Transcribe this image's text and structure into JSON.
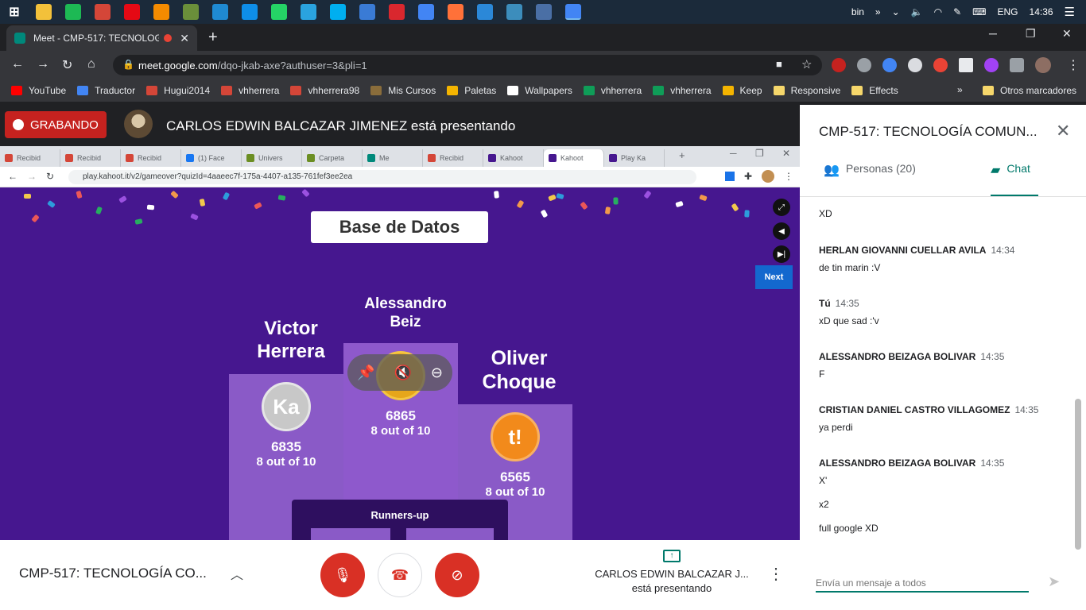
{
  "taskbar": {
    "icons": [
      {
        "name": "windows-start-icon",
        "color": "#1b2a3a"
      },
      {
        "name": "file-explorer-icon",
        "color": "#f3c13a"
      },
      {
        "name": "spotify-icon",
        "color": "#1db954"
      },
      {
        "name": "gmail-app-icon",
        "color": "#d44638"
      },
      {
        "name": "netflix-icon",
        "color": "#e50914"
      },
      {
        "name": "vlc-icon",
        "color": "#f48b00"
      },
      {
        "name": "app-icon",
        "color": "#6a8f3a"
      },
      {
        "name": "vscode-icon",
        "color": "#1f8ad2"
      },
      {
        "name": "teamviewer-icon",
        "color": "#0e8ee9"
      },
      {
        "name": "whatsapp-icon",
        "color": "#25d366"
      },
      {
        "name": "telegram-icon",
        "color": "#2aa3df"
      },
      {
        "name": "skype-icon",
        "color": "#00aff0"
      },
      {
        "name": "store-icon",
        "color": "#3a7bd5"
      },
      {
        "name": "mega-icon",
        "color": "#d9272e"
      },
      {
        "name": "drive-icon",
        "color": "#4285f4"
      },
      {
        "name": "firefox-icon",
        "color": "#ff7139"
      },
      {
        "name": "remote-desktop-icon",
        "color": "#2b88d8"
      },
      {
        "name": "search-app-icon",
        "color": "#3c8dbc"
      },
      {
        "name": "photos-icon",
        "color": "#4a6fa5"
      },
      {
        "name": "chrome-icon",
        "color": "#4285f4"
      }
    ],
    "tray_label": "bin",
    "language": "ENG",
    "clock": "14:36"
  },
  "browser": {
    "tab_title": "Meet - CMP-517: TECNOLOG",
    "url_host": "meet.google.com",
    "url_path": "/dqo-jkab-axe?authuser=3&pli=1",
    "new_tab": "+",
    "bookmarks": [
      {
        "label": "YouTube",
        "color": "#ff0000"
      },
      {
        "label": "Traductor",
        "color": "#4285f4"
      },
      {
        "label": "Hugui2014",
        "color": "#d44638"
      },
      {
        "label": "vhherrera",
        "color": "#d44638"
      },
      {
        "label": "vhherrera98",
        "color": "#d44638"
      },
      {
        "label": "Mis Cursos",
        "color": "#8a6d3b"
      },
      {
        "label": "Paletas",
        "color": "#f4b400"
      },
      {
        "label": "Wallpapers",
        "color": "#ffffff"
      },
      {
        "label": "vhherrera",
        "color": "#0f9d58"
      },
      {
        "label": "vhherrera",
        "color": "#0f9d58"
      },
      {
        "label": "Keep",
        "color": "#f4b400"
      },
      {
        "label": "Responsive",
        "color": "#f6d76b"
      },
      {
        "label": "Effects",
        "color": "#f6d76b"
      }
    ],
    "bookmarks_more": "»",
    "other_bookmarks": "Otros marcadores"
  },
  "meet": {
    "recording_label": "GRABANDO",
    "presenter_banner": "CARLOS EDWIN BALCAZAR JIMENEZ está presentando",
    "meeting_name": "CMP-517: TECNOLOGÍA CO...",
    "presenting_name": "CARLOS EDWIN BALCAZAR J...",
    "presenting_status": "está presentando",
    "panel": {
      "title": "CMP-517: TECNOLOGÍA COMUN...",
      "people_tab": "Personas (20)",
      "chat_tab": "Chat",
      "input_placeholder": "Envía un mensaje a todos",
      "messages": [
        {
          "sender": "",
          "time": "",
          "lines": [
            "XD"
          ]
        },
        {
          "sender": "HERLAN GIOVANNI CUELLAR AVILA",
          "time": "14:34",
          "lines": [
            "de tin marin :V"
          ]
        },
        {
          "sender": "Tú",
          "time": "14:35",
          "lines": [
            "xD que sad :'v"
          ]
        },
        {
          "sender": "ALESSANDRO BEIZAGA BOLIVAR",
          "time": "14:35",
          "lines": [
            "F"
          ]
        },
        {
          "sender": "CRISTIAN DANIEL CASTRO VILLAGOMEZ",
          "time": "14:35",
          "lines": [
            "ya perdi"
          ]
        },
        {
          "sender": "ALESSANDRO BEIZAGA BOLIVAR",
          "time": "14:35",
          "lines": [
            "X'",
            "x2",
            "full google XD"
          ]
        }
      ]
    }
  },
  "shared_screen": {
    "tabs": [
      {
        "label": "Recibid",
        "color": "#d44638"
      },
      {
        "label": "Recibid",
        "color": "#d44638"
      },
      {
        "label": "Recibid",
        "color": "#d44638"
      },
      {
        "label": "(1) Face",
        "color": "#1877f2"
      },
      {
        "label": "Univers",
        "color": "#6b8e23"
      },
      {
        "label": "Carpeta",
        "color": "#6b8e23"
      },
      {
        "label": "Me",
        "color": "#00897b"
      },
      {
        "label": "Recibid",
        "color": "#d44638"
      },
      {
        "label": "Kahoot",
        "color": "#46178f"
      },
      {
        "label": "Kahoot",
        "color": "#46178f"
      },
      {
        "label": "Play Ka",
        "color": "#46178f"
      }
    ],
    "active_tab_index": 9,
    "url": "play.kahoot.it/v2/gameover?quizId=4aaeec7f-175a-4407-a135-761fef3ee2ea",
    "kahoot": {
      "title": "Base de Datos",
      "first": {
        "name": "Alessandro Beiz",
        "score": "6865",
        "correct": "8 out of 10"
      },
      "second": {
        "name": "Victor Herrera",
        "score": "6835",
        "correct": "8 out of 10",
        "badge": "Ka"
      },
      "third": {
        "name": "Oliver Choque",
        "score": "6565",
        "correct": "8 out of 10",
        "badge": "t!"
      },
      "runners_up": "Runners-up",
      "next_label": "Next"
    }
  }
}
